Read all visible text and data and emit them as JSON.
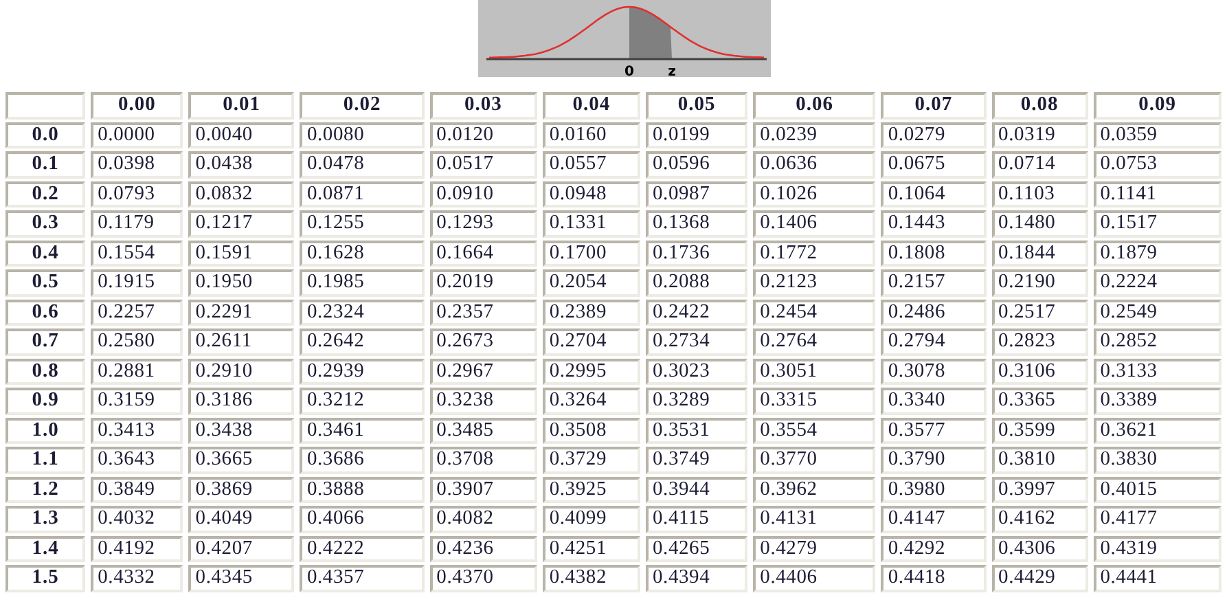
{
  "figure": {
    "labels": [
      "0",
      "z"
    ]
  },
  "table": {
    "columns": [
      "",
      "0.00",
      "0.01",
      "0.02",
      "0.03",
      "0.04",
      "0.05",
      "0.06",
      "0.07",
      "0.08",
      "0.09"
    ],
    "rows": [
      {
        "cells": [
          "0.0",
          "0.0000",
          "0.0040",
          "0.0080",
          "0.0120",
          "0.0160",
          "0.0199",
          "0.0239",
          "0.0279",
          "0.0319",
          "0.0359"
        ]
      },
      {
        "cells": [
          "0.1",
          "0.0398",
          "0.0438",
          "0.0478",
          "0.0517",
          "0.0557",
          "0.0596",
          "0.0636",
          "0.0675",
          "0.0714",
          "0.0753"
        ]
      },
      {
        "cells": [
          "0.2",
          "0.0793",
          "0.0832",
          "0.0871",
          "0.0910",
          "0.0948",
          "0.0987",
          "0.1026",
          "0.1064",
          "0.1103",
          "0.1141"
        ]
      },
      {
        "cells": [
          "0.3",
          "0.1179",
          "0.1217",
          "0.1255",
          "0.1293",
          "0.1331",
          "0.1368",
          "0.1406",
          "0.1443",
          "0.1480",
          "0.1517"
        ]
      },
      {
        "cells": [
          "0.4",
          "0.1554",
          "0.1591",
          "0.1628",
          "0.1664",
          "0.1700",
          "0.1736",
          "0.1772",
          "0.1808",
          "0.1844",
          "0.1879"
        ]
      },
      {
        "cells": [
          "0.5",
          "0.1915",
          "0.1950",
          "0.1985",
          "0.2019",
          "0.2054",
          "0.2088",
          "0.2123",
          "0.2157",
          "0.2190",
          "0.2224"
        ]
      },
      {
        "cells": [
          "0.6",
          "0.2257",
          "0.2291",
          "0.2324",
          "0.2357",
          "0.2389",
          "0.2422",
          "0.2454",
          "0.2486",
          "0.2517",
          "0.2549"
        ]
      },
      {
        "cells": [
          "0.7",
          "0.2580",
          "0.2611",
          "0.2642",
          "0.2673",
          "0.2704",
          "0.2734",
          "0.2764",
          "0.2794",
          "0.2823",
          "0.2852"
        ]
      },
      {
        "cells": [
          "0.8",
          "0.2881",
          "0.2910",
          "0.2939",
          "0.2967",
          "0.2995",
          "0.3023",
          "0.3051",
          "0.3078",
          "0.3106",
          "0.3133"
        ]
      },
      {
        "cells": [
          "0.9",
          "0.3159",
          "0.3186",
          "0.3212",
          "0.3238",
          "0.3264",
          "0.3289",
          "0.3315",
          "0.3340",
          "0.3365",
          "0.3389"
        ]
      },
      {
        "cells": [
          "1.0",
          "0.3413",
          "0.3438",
          "0.3461",
          "0.3485",
          "0.3508",
          "0.3531",
          "0.3554",
          "0.3577",
          "0.3599",
          "0.3621"
        ]
      },
      {
        "cells": [
          "1.1",
          "0.3643",
          "0.3665",
          "0.3686",
          "0.3708",
          "0.3729",
          "0.3749",
          "0.3770",
          "0.3790",
          "0.3810",
          "0.3830"
        ]
      },
      {
        "cells": [
          "1.2",
          "0.3849",
          "0.3869",
          "0.3888",
          "0.3907",
          "0.3925",
          "0.3944",
          "0.3962",
          "0.3980",
          "0.3997",
          "0.4015"
        ]
      },
      {
        "cells": [
          "1.3",
          "0.4032",
          "0.4049",
          "0.4066",
          "0.4082",
          "0.4099",
          "0.4115",
          "0.4131",
          "0.4147",
          "0.4162",
          "0.4177"
        ]
      },
      {
        "cells": [
          "1.4",
          "0.4192",
          "0.4207",
          "0.4222",
          "0.4236",
          "0.4251",
          "0.4265",
          "0.4279",
          "0.4292",
          "0.4306",
          "0.4319"
        ]
      },
      {
        "cells": [
          "1.5",
          "0.4332",
          "0.4345",
          "0.4357",
          "0.4370",
          "0.4382",
          "0.4394",
          "0.4406",
          "0.4418",
          "0.4429",
          "0.4441"
        ]
      }
    ]
  }
}
